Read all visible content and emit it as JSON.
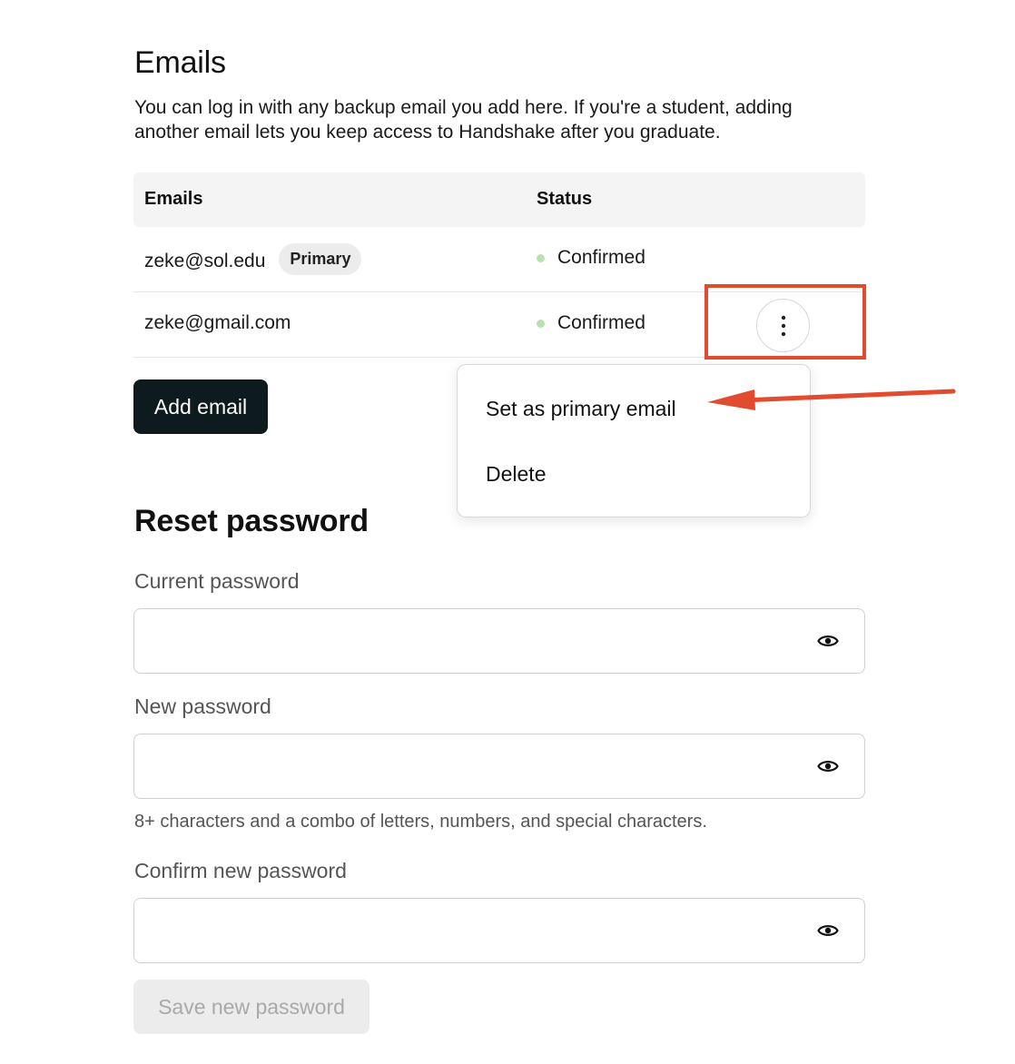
{
  "emails_section": {
    "title": "Emails",
    "description": "You can log in with any backup email you add here. If you're a student, adding another email lets you keep access to Handshake after you graduate."
  },
  "table": {
    "headers": [
      "Emails",
      "Status"
    ],
    "rows": [
      {
        "email": "zeke@sol.edu",
        "badge": "Primary",
        "status": "Confirmed"
      },
      {
        "email": "zeke@gmail.com",
        "status": "Confirmed",
        "menu_icon": "more-vertical-icon"
      }
    ],
    "status_color": "#b9e0b0"
  },
  "add_email_label": "Add email",
  "row_menu": {
    "items": [
      "Set as primary email",
      "Delete"
    ]
  },
  "annotation": {
    "color": "#e34b2e"
  },
  "reset_password": {
    "title": "Reset password",
    "current_label": "Current password",
    "new_label": "New password",
    "hint": "8+ characters and a combo of letters, numbers, and special characters.",
    "confirm_label": "Confirm new password",
    "save_label": "Save new password",
    "toggle_icon": "eye-icon"
  }
}
